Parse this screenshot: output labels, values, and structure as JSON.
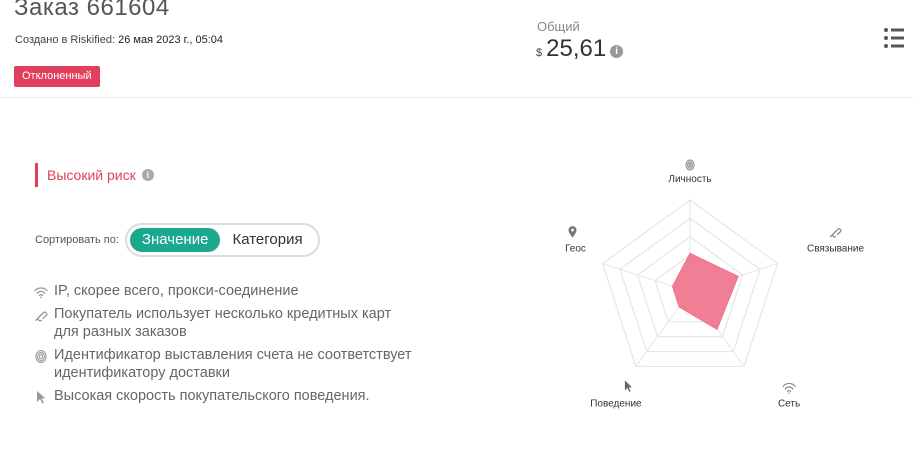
{
  "order": {
    "title": "Заказ 661604",
    "created_label": "Создано в Riskified:",
    "created_value": "26 мая 2023 г., 05:04",
    "status_badge": "Отклоненный",
    "total_label": "Общий",
    "total_currency": "$",
    "total_amount": "25,61"
  },
  "risk": {
    "label": "Высокий риск"
  },
  "sort": {
    "label": "Сортировать по:",
    "options": [
      "Значение",
      "Категория"
    ],
    "selected": "Значение"
  },
  "reasons": [
    {
      "icon": "wifi-icon",
      "text": "IP, скорее всего, прокси-соединение"
    },
    {
      "icon": "link-icon",
      "text": "Покупатель использует несколько кредитных карт для разных заказов"
    },
    {
      "icon": "fingerprint-icon",
      "text": "Идентификатор выставления счета не соответствует идентификатору доставки"
    },
    {
      "icon": "cursor-icon",
      "text": "Высокая скорость покупательского поведения."
    }
  ],
  "radar": {
    "axes": [
      {
        "label": "Личность",
        "icon": "fingerprint-icon",
        "value": 0.42
      },
      {
        "label": "Связывание",
        "icon": "link-icon",
        "value": 0.55
      },
      {
        "label": "Сеть",
        "icon": "wifi-icon",
        "value": 0.5
      },
      {
        "label": "Поведение",
        "icon": "cursor-icon",
        "value": 0.2
      },
      {
        "label": "Геос",
        "icon": "location-pin-icon",
        "value": 0.2
      }
    ],
    "levels": 5,
    "fill_color": "#f07088",
    "grid_color": "#e6e6e6"
  },
  "colors": {
    "accent": "#e0405e",
    "toggle_active": "#1aa88e"
  }
}
